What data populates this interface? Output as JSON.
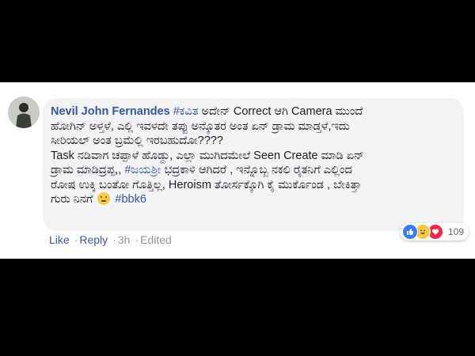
{
  "comment": {
    "author": "Nevil John Fernandes",
    "line1_tag": "#ಕವಿತ",
    "line1_text": " ಅದೇನ್ Correct ಆಗಿ Camera ಮುಂದೆ",
    "line2": "ಹೋಗಿನ್ ಅಳ್ತಳೆ, ಎಲ್ಲಿ ಇವಳದೇ ತಪ್ಪು ಅನ್ಕೊತರ ಅಂತ ಏನ್ ಡ್ರಾಮ ಮಾಡ್ತಳೆ,ಇದು",
    "line3": "ಸೀರಿಯಲ್ ಅಂತ ಬ್ರಮೆಲ್ಲಿ ಇರಬಹುದೋ????",
    "line4": "Task ನಡಿವಾಗ ಚಪ್ಪಾಳೆ ಹೊಡ್ದು, ಎಲ್ಲಾ ಮುಗಿದಮೇಲೆ Seen Create ಮಾಡಿ ಏನ್",
    "line5_text": "ಡ್ರಾಮ ಮಾಡಿದ್ರಪ್ಪ,, ",
    "line5_tag": "#ಜಯಶ್ರೀ",
    "line5_rest": " ಭದ್ರಕಾಳಿ ಆಗಿದರೆ , ಇನ್ನೊಬ್ಬ ನಕಲಿ ರೈತನಿಗೆ ಎಲ್ಲಿಂದ",
    "line6": "ರೋಷ ಉಕ್ಕಿ ಬಂತೋ ಗೊತ್ತಿಲ್ಲ, Heroism ತೋರ್ಸಕ್ಕೊಗಿ ಕೈ ಮುರ್ಕೊಂಡ , ಬೇಕಿತ್ತಾ",
    "line7_text": "ಗುರು ನಿನಗೆ ",
    "line7_tag": "#bbk6"
  },
  "emoji_icon": "thinking-face-emoji",
  "reactions": {
    "icons": [
      "like-icon",
      "haha-icon",
      "love-icon"
    ],
    "count": "109"
  },
  "actions": {
    "like": "Like",
    "reply": "Reply",
    "time": "3h",
    "edited": "Edited"
  },
  "colors": {
    "link": "#365899",
    "bubble": "#f2f3f5",
    "meta": "#90949c"
  }
}
